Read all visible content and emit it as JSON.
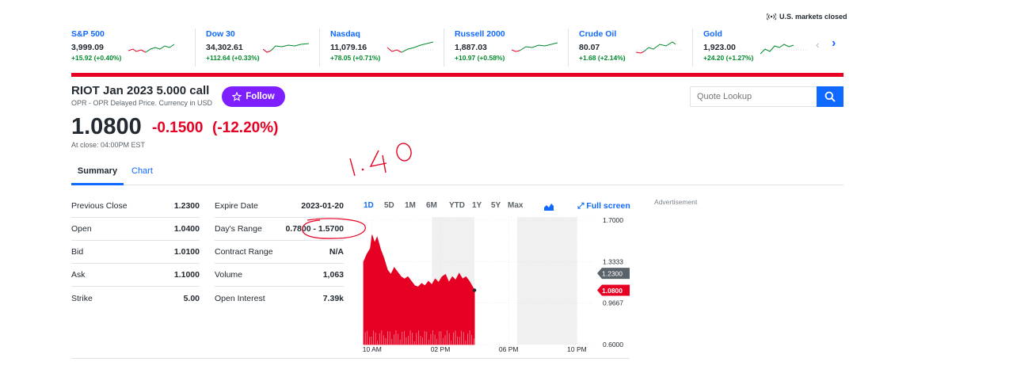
{
  "market_status": "U.S. markets closed",
  "tickers": [
    {
      "name": "S&P 500",
      "price": "3,999.09",
      "change": "+15.92 (+0.40%)"
    },
    {
      "name": "Dow 30",
      "price": "34,302.61",
      "change": "+112.64 (+0.33%)"
    },
    {
      "name": "Nasdaq",
      "price": "11,079.16",
      "change": "+78.05 (+0.71%)"
    },
    {
      "name": "Russell 2000",
      "price": "1,887.03",
      "change": "+10.97 (+0.58%)"
    },
    {
      "name": "Crude Oil",
      "price": "80.07",
      "change": "+1.68 (+2.14%)"
    },
    {
      "name": "Gold",
      "price": "1,923.00",
      "change": "+24.20 (+1.27%)"
    }
  ],
  "quote": {
    "title": "RIOT Jan 2023 5.000 call",
    "subtitle": "OPR - OPR Delayed Price. Currency in USD",
    "follow_label": "Follow",
    "price": "1.0800",
    "change": "-0.1500",
    "change_pct": "(-12.20%)",
    "close_note": "At close: 04:00PM EST"
  },
  "search": {
    "placeholder": "Quote Lookup"
  },
  "tabs": [
    "Summary",
    "Chart"
  ],
  "annotation": "1.40",
  "stats_left": [
    {
      "label": "Previous Close",
      "value": "1.2300"
    },
    {
      "label": "Open",
      "value": "1.0400"
    },
    {
      "label": "Bid",
      "value": "1.0100"
    },
    {
      "label": "Ask",
      "value": "1.1000"
    },
    {
      "label": "Strike",
      "value": "5.00"
    }
  ],
  "stats_right": [
    {
      "label": "Expire Date",
      "value": "2023-01-20"
    },
    {
      "label": "Day's Range",
      "value": "0.7800 - 1.5700"
    },
    {
      "label": "Contract Range",
      "value": "N/A"
    },
    {
      "label": "Volume",
      "value": "1,063"
    },
    {
      "label": "Open Interest",
      "value": "7.39k"
    }
  ],
  "chart": {
    "ranges": [
      "1D",
      "5D",
      "1M",
      "6M",
      "YTD",
      "1Y",
      "5Y",
      "Max"
    ],
    "fullscreen_label": "Full screen",
    "y_ticks": [
      "1.7000",
      "1.3333",
      "0.9667",
      "0.6000"
    ],
    "prev_close_label": "1.2300",
    "current_label": "1.0800",
    "x_ticks": [
      "10 AM",
      "02 PM",
      "06 PM",
      "10 PM"
    ],
    "colors": {
      "area": "#e60023",
      "prev_close": "#5b636a",
      "shade": "#f0f0f0"
    }
  },
  "advertisement": "Advertisement",
  "chart_data": {
    "type": "area",
    "y_range": [
      0.6,
      1.7
    ],
    "x_range_hours": [
      9.5,
      23
    ],
    "series": [
      {
        "values": [
          [
            9.5,
            1.33
          ],
          [
            9.7,
            1.4
          ],
          [
            9.9,
            1.45
          ],
          [
            10.0,
            1.57
          ],
          [
            10.15,
            1.5
          ],
          [
            10.3,
            1.55
          ],
          [
            10.5,
            1.44
          ],
          [
            10.7,
            1.36
          ],
          [
            10.9,
            1.26
          ],
          [
            11.1,
            1.22
          ],
          [
            11.3,
            1.28
          ],
          [
            11.5,
            1.24
          ],
          [
            11.7,
            1.2
          ],
          [
            11.9,
            1.18
          ],
          [
            12.1,
            1.2
          ],
          [
            12.3,
            1.16
          ],
          [
            12.5,
            1.12
          ],
          [
            12.7,
            1.11
          ],
          [
            12.9,
            1.14
          ],
          [
            13.1,
            1.12
          ],
          [
            13.3,
            1.16
          ],
          [
            13.5,
            1.13
          ],
          [
            13.7,
            1.18
          ],
          [
            13.9,
            1.15
          ],
          [
            14.1,
            1.2
          ],
          [
            14.3,
            1.22
          ],
          [
            14.5,
            1.15
          ],
          [
            14.7,
            1.2
          ],
          [
            14.9,
            1.17
          ],
          [
            15.1,
            1.23
          ],
          [
            15.3,
            1.18
          ],
          [
            15.5,
            1.2
          ],
          [
            15.7,
            1.16
          ],
          [
            16.0,
            1.08
          ]
        ]
      }
    ]
  }
}
